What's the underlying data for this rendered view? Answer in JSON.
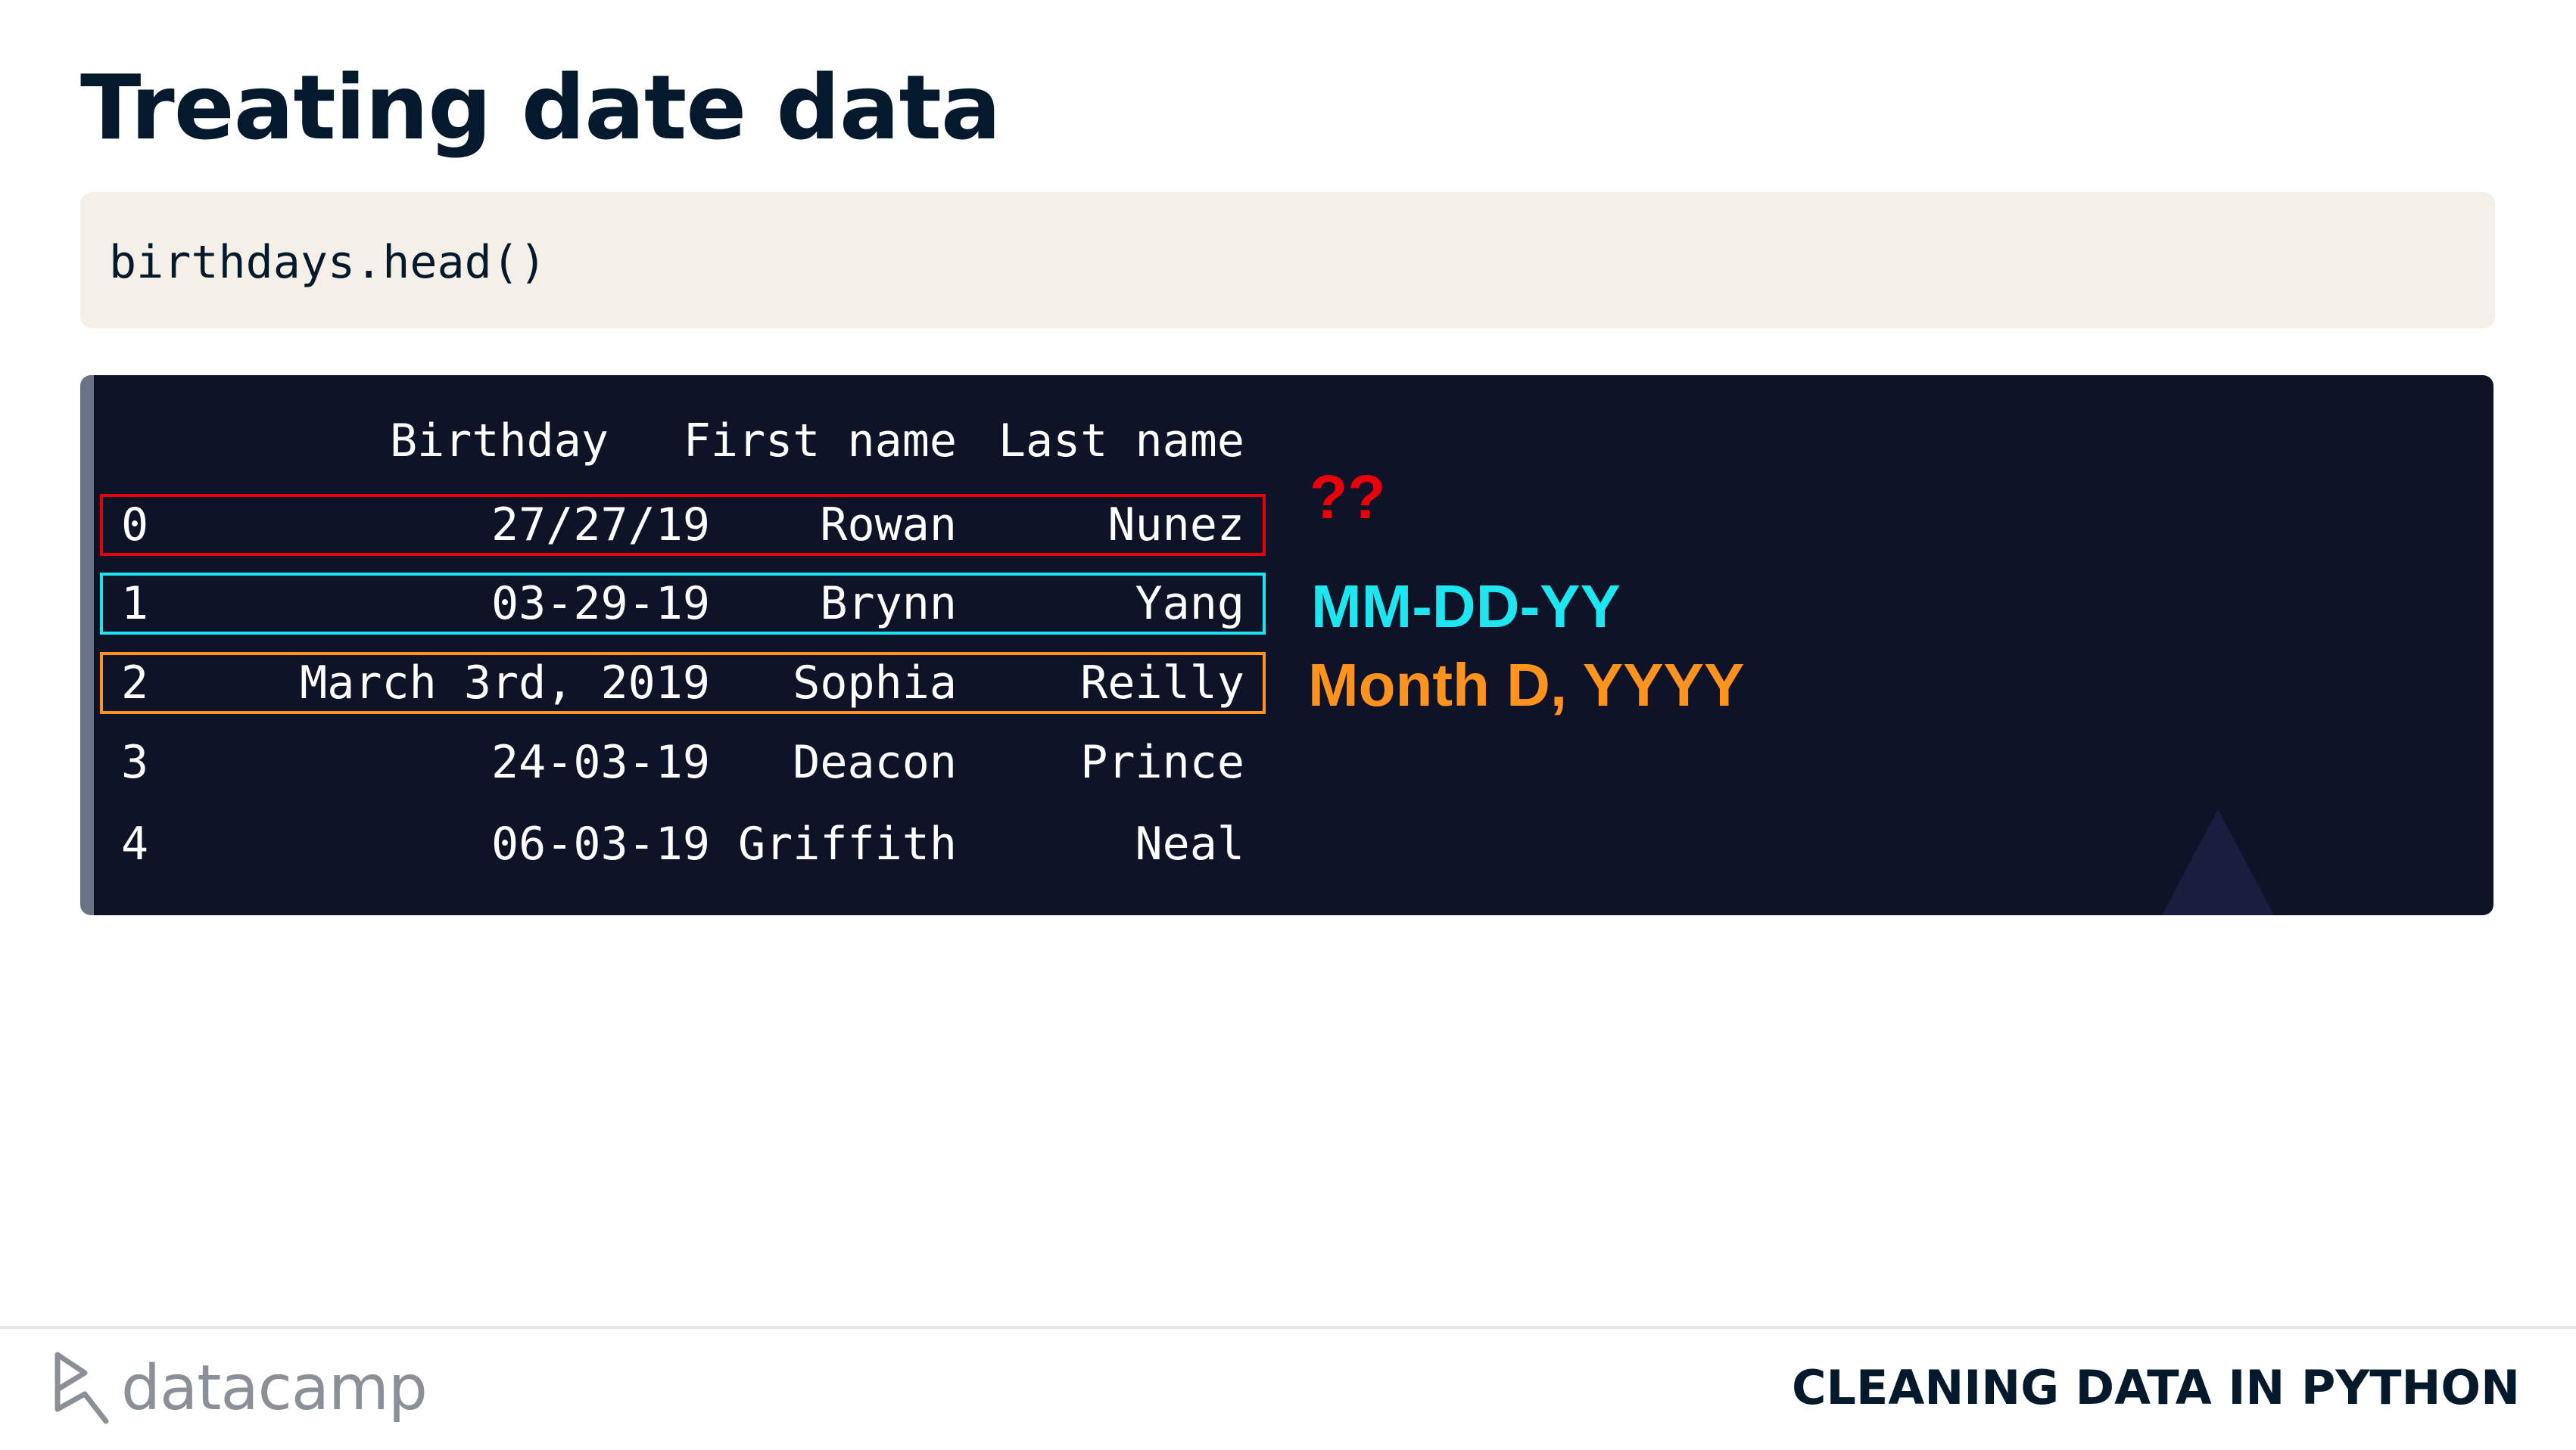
{
  "slide": {
    "title": "Treating date data"
  },
  "code": {
    "text": "birthdays.head()"
  },
  "output": {
    "columns": [
      "Birthday",
      "First name",
      "Last name"
    ],
    "rows": [
      {
        "index": "0",
        "birthday": "27/27/19",
        "first_name": "Rowan",
        "last_name": "Nunez"
      },
      {
        "index": "1",
        "birthday": "03-29-19",
        "first_name": "Brynn",
        "last_name": "Yang"
      },
      {
        "index": "2",
        "birthday": "March 3rd, 2019",
        "first_name": "Sophia",
        "last_name": "Reilly"
      },
      {
        "index": "3",
        "birthday": "24-03-19",
        "first_name": "Deacon",
        "last_name": "Prince"
      },
      {
        "index": "4",
        "birthday": "06-03-19",
        "first_name": "Griffith",
        "last_name": "Neal"
      }
    ]
  },
  "annotations": [
    {
      "text": "??",
      "color": "#e8000b"
    },
    {
      "text": "MM-DD-YY",
      "color": "#1de6f0"
    },
    {
      "text": "Month D, YYYY",
      "color": "#ff931e"
    }
  ],
  "footer": {
    "logo_text": "datacamp",
    "logo_icon": "datacamp-logo-icon",
    "course_name": "CLEANING DATA IN PYTHON"
  },
  "colors": {
    "title": "#05192d",
    "code_background": "#f4f0e8",
    "output_background": "#0f1327",
    "highlight_red": "#e8000b",
    "highlight_cyan": "#1de6f0",
    "highlight_orange": "#ff931e"
  }
}
